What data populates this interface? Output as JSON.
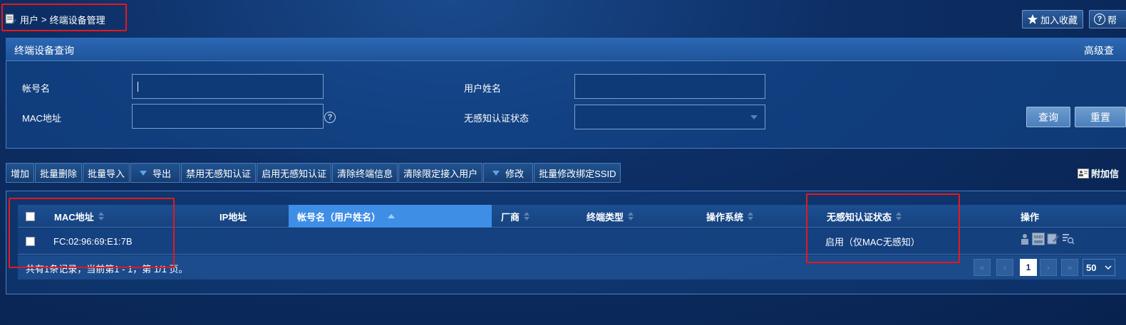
{
  "breadcrumb": {
    "root": "用户",
    "sep": ">",
    "current": "终端设备管理"
  },
  "topbar": {
    "favorite_label": "加入收藏",
    "help_label": "帮"
  },
  "query_panel": {
    "title": "终端设备查询",
    "advanced_label": "高级查",
    "fields": {
      "account_label": "帐号名",
      "account_value": "",
      "username_label": "用户姓名",
      "username_value": "",
      "mac_label": "MAC地址",
      "mac_value": "",
      "auth_status_label": "无感知认证状态",
      "auth_status_value": ""
    },
    "help_glyph": "?",
    "search_label": "查询",
    "reset_label": "重置"
  },
  "toolbar": {
    "buttons": [
      {
        "label": "增加",
        "dropdown": false
      },
      {
        "label": "批量删除",
        "dropdown": false
      },
      {
        "label": "批量导入",
        "dropdown": false
      },
      {
        "label": "导出",
        "dropdown": true
      },
      {
        "label": "禁用无感知认证",
        "dropdown": false
      },
      {
        "label": "启用无感知认证",
        "dropdown": false
      },
      {
        "label": "清除终端信息",
        "dropdown": false
      },
      {
        "label": "清除限定接入用户",
        "dropdown": false
      },
      {
        "label": "修改",
        "dropdown": true
      },
      {
        "label": "批量修改绑定SSID",
        "dropdown": false
      }
    ],
    "attach_label": "附加信"
  },
  "table": {
    "columns": {
      "mac": "MAC地址",
      "ip": "IP地址",
      "account": "帐号名（用户姓名）",
      "vendor": "厂商",
      "device_type": "终端类型",
      "os": "操作系统",
      "auth_status": "无感知认证状态",
      "action": "操作"
    },
    "rows": [
      {
        "mac": "FC:02:96:69:E1:7B",
        "ip": "",
        "account": "",
        "vendor": "",
        "device_type": "",
        "os": "",
        "auth_status": "启用（仅MAC无感知）",
        "ssid_icon_text": "SSID"
      }
    ]
  },
  "pager": {
    "summary": "共有1条记录，当前第1 - 1，第 1/1 页。",
    "current_page": "1",
    "page_size": "50"
  },
  "colors": {
    "highlight": "#e8171c",
    "sorted_header": "#3f8ee6",
    "panel_header": "#2c68b5"
  }
}
